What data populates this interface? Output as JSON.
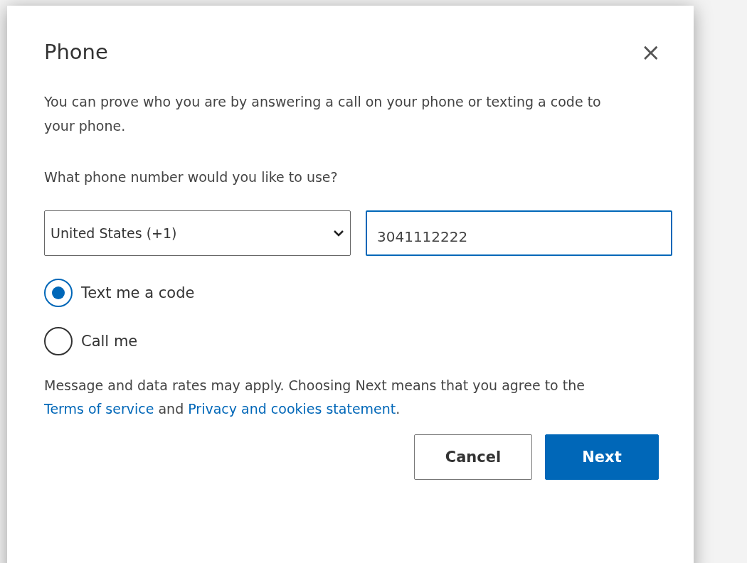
{
  "dialog": {
    "title": "Phone",
    "close_label": "×"
  },
  "intro": "You can prove who you are by answering a call on your phone or texting a code to your phone.",
  "question": "What phone number would you like to use?",
  "country_select": {
    "value": "United States (+1)"
  },
  "phone_field": {
    "value": "3041112222",
    "focused": true
  },
  "options": [
    {
      "label": "Text me a code",
      "selected": true
    },
    {
      "label": "Call me",
      "selected": false
    }
  ],
  "disclaimer": {
    "before": "Message and data rates may apply. Choosing Next means that you agree to the ",
    "terms_link": "Terms of service",
    "middle": " and ",
    "privacy_link": "Privacy and cookies statement",
    "after": "."
  },
  "buttons": {
    "cancel": "Cancel",
    "next": "Next"
  }
}
